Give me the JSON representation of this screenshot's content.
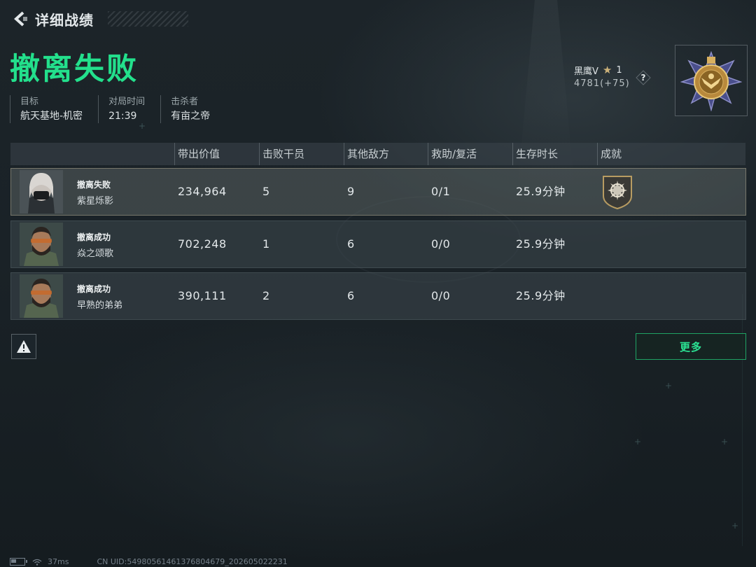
{
  "header": {
    "title": "详细战绩"
  },
  "result": {
    "title": "撤离失败"
  },
  "info": [
    {
      "label": "目标",
      "value": "航天基地-机密"
    },
    {
      "label": "对局时间",
      "value": "21:39"
    },
    {
      "label": "击杀者",
      "value": "有亩之帝"
    }
  ],
  "rank": {
    "name": "黑鹰V",
    "stars": "1",
    "score": "4781(+75)",
    "help": "?"
  },
  "table": {
    "headers": [
      "带出价值",
      "击败干员",
      "其他敌方",
      "救助/复活",
      "生存时长",
      "成就"
    ],
    "rows": [
      {
        "status": "撤离失败",
        "name": "紫星烁影",
        "value": "234,964",
        "kills": "5",
        "others": "9",
        "assist": "0/1",
        "time": "25.9分钟",
        "selected": true,
        "has_achievement": true
      },
      {
        "status": "撤离成功",
        "name": "焱之颂歌",
        "value": "702,248",
        "kills": "1",
        "others": "6",
        "assist": "0/0",
        "time": "25.9分钟",
        "selected": false,
        "has_achievement": false
      },
      {
        "status": "撤离成功",
        "name": "早熟的弟弟",
        "value": "390,111",
        "kills": "2",
        "others": "6",
        "assist": "0/0",
        "time": "25.9分钟",
        "selected": false,
        "has_achievement": false
      }
    ]
  },
  "buttons": {
    "more": "更多"
  },
  "footer": {
    "ping": "37ms",
    "uid": "CN UID:5498056146137680467​9_202605022231",
    "battery_level": 0.4
  },
  "colors": {
    "accent": "#23e08c",
    "more_border": "#1fa364",
    "gold": "#cdb27a"
  }
}
